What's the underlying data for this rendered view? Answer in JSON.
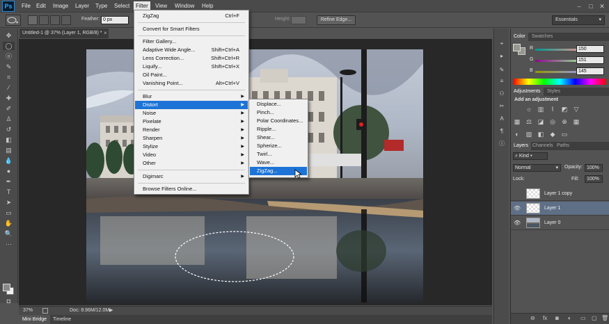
{
  "app": {
    "logo": "Ps"
  },
  "menubar": {
    "items": [
      "File",
      "Edit",
      "Image",
      "Layer",
      "Type",
      "Select",
      "Filter",
      "View",
      "Window",
      "Help"
    ],
    "active": "Filter"
  },
  "window_controls": {
    "minimize": "–",
    "maximize": "□",
    "close": "✕"
  },
  "options_bar": {
    "feather_label": "Feather:",
    "feather_value": "0 px",
    "height_label": "Height:",
    "refine_edge": "Refine Edge...",
    "workspace": "Essentials"
  },
  "document": {
    "tab_title": "Untitled-1 @ 37% (Layer 1, RGB/8) *",
    "close": "×"
  },
  "status_bar": {
    "zoom": "37%",
    "doc_info": "Doc: 8.96M/12.0M"
  },
  "bottom_tabs": [
    "Mini Bridge",
    "Timeline"
  ],
  "filter_menu": {
    "items": [
      {
        "label": "ZigZag",
        "shortcut": "Ctrl+F"
      },
      {
        "label": "Convert for Smart Filters"
      },
      {
        "label": "Filter Gallery..."
      },
      {
        "label": "Adaptive Wide Angle...",
        "shortcut": "Shift+Ctrl+A"
      },
      {
        "label": "Lens Correction...",
        "shortcut": "Shift+Ctrl+R"
      },
      {
        "label": "Liquify...",
        "shortcut": "Shift+Ctrl+X"
      },
      {
        "label": "Oil Paint..."
      },
      {
        "label": "Vanishing Point...",
        "shortcut": "Alt+Ctrl+V"
      },
      {
        "label": "Blur"
      },
      {
        "label": "Distort"
      },
      {
        "label": "Noise"
      },
      {
        "label": "Pixelate"
      },
      {
        "label": "Render"
      },
      {
        "label": "Sharpen"
      },
      {
        "label": "Stylize"
      },
      {
        "label": "Video"
      },
      {
        "label": "Other"
      },
      {
        "label": "Digimarc"
      },
      {
        "label": "Browse Filters Online..."
      }
    ],
    "highlighted": "Distort"
  },
  "distort_menu": {
    "items": [
      "Displace...",
      "Pinch...",
      "Polar Coordinates...",
      "Ripple...",
      "Shear...",
      "Spherize...",
      "Twirl...",
      "Wave...",
      "ZigZag..."
    ],
    "highlighted": "ZigZag..."
  },
  "color_panel": {
    "tabs": [
      "Color",
      "Swatches"
    ],
    "r_label": "R",
    "r_value": "150",
    "g_label": "G",
    "g_value": "151",
    "b_label": "B",
    "b_value": "145"
  },
  "adjustments_panel": {
    "tabs": [
      "Adjustments",
      "Styles"
    ],
    "heading": "Add an adjustment"
  },
  "layers_panel": {
    "tabs": [
      "Layers",
      "Channels",
      "Paths"
    ],
    "filter_kind": "Kind",
    "blend_mode": "Normal",
    "opacity_label": "Opacity:",
    "opacity_value": "100%",
    "lock_label": "Lock:",
    "fill_label": "Fill:",
    "fill_value": "100%",
    "layers": [
      {
        "name": "Layer 1 copy",
        "visible": false,
        "selected": false
      },
      {
        "name": "Layer 1",
        "visible": true,
        "selected": true
      },
      {
        "name": "Layer 0",
        "visible": true,
        "selected": false
      }
    ]
  },
  "icons": {
    "eye": "👁",
    "submenu_arrow": "▶",
    "dropdown": "▾"
  }
}
